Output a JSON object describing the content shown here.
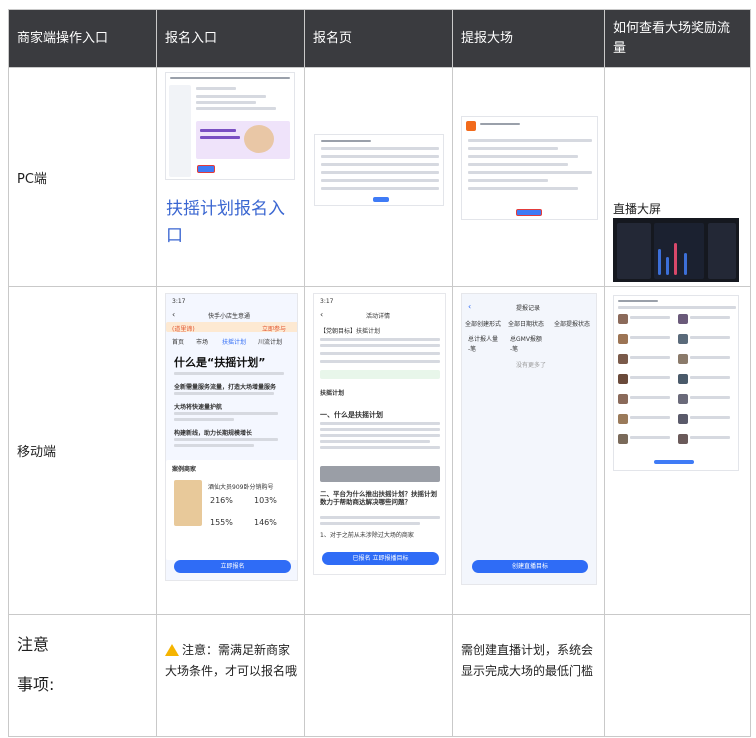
{
  "headers": [
    "商家端操作入口",
    "报名入口",
    "报名页",
    "提报大场",
    "如何查看大场奖励流量"
  ],
  "rows": {
    "pc_label": "PC端",
    "mobile_label": "移动端",
    "note_label_line1": "注意",
    "note_label_line2": "事项:"
  },
  "pc": {
    "signup_link_text": "扶摇计划报名入口",
    "big_screen_label": "直播大屏"
  },
  "mobile": {
    "signup_screen": {
      "time": "3:17",
      "app_title": "快手小店生意通",
      "notice": "(道里谛)",
      "notice_action": "立即参与",
      "tabs": [
        "首页",
        "市场",
        "扶摇计划",
        "川流计划"
      ],
      "headline": "什么是“扶摇计划”",
      "section1": "全新需量服务流量，打造大场增量服务",
      "section2": "大场将快速量护航",
      "section3": "构建新线，助力长期规模增长",
      "case_title": "案例商家",
      "case_name": "酒仙大员909卧分销购号",
      "metrics": [
        "216%",
        "103%",
        "155%",
        "146%"
      ],
      "button": "立即报名"
    },
    "activity_screen": {
      "time": "3:17",
      "title": "活动详情",
      "name_line": "【党朝目标】扶摇计划",
      "plan_title": "扶摇计划",
      "q1": "一、什么是扶摇计划",
      "q2": "二、平台为什么推出扶摇计划？扶摇计划数力于帮助商达解决哪些问题？",
      "footer_line": "1、对于之前从未涉除过大场的商家",
      "button": "已报名 立即报播目标"
    },
    "report_screen": {
      "title": "提报记录",
      "filters": [
        "全部创建形式",
        "全部日期状态",
        "全部提报状态"
      ],
      "col1_label": "总计报人量",
      "col1_value": "-笔",
      "col2_label": "总GMV报额",
      "col2_value": "-笔",
      "empty": "没有更多了",
      "button": "创建直播目标"
    }
  },
  "notes": {
    "signup": "注意：需满足新商家大场条件，才可以报名哦",
    "report": "需创建直播计划，系统会显示完成大场的最低门槛"
  },
  "colors": {
    "header_bg": "#3a3b3f",
    "link": "#3a66d1",
    "primary_button": "#2f6cf6",
    "warning": "#f5b400"
  }
}
